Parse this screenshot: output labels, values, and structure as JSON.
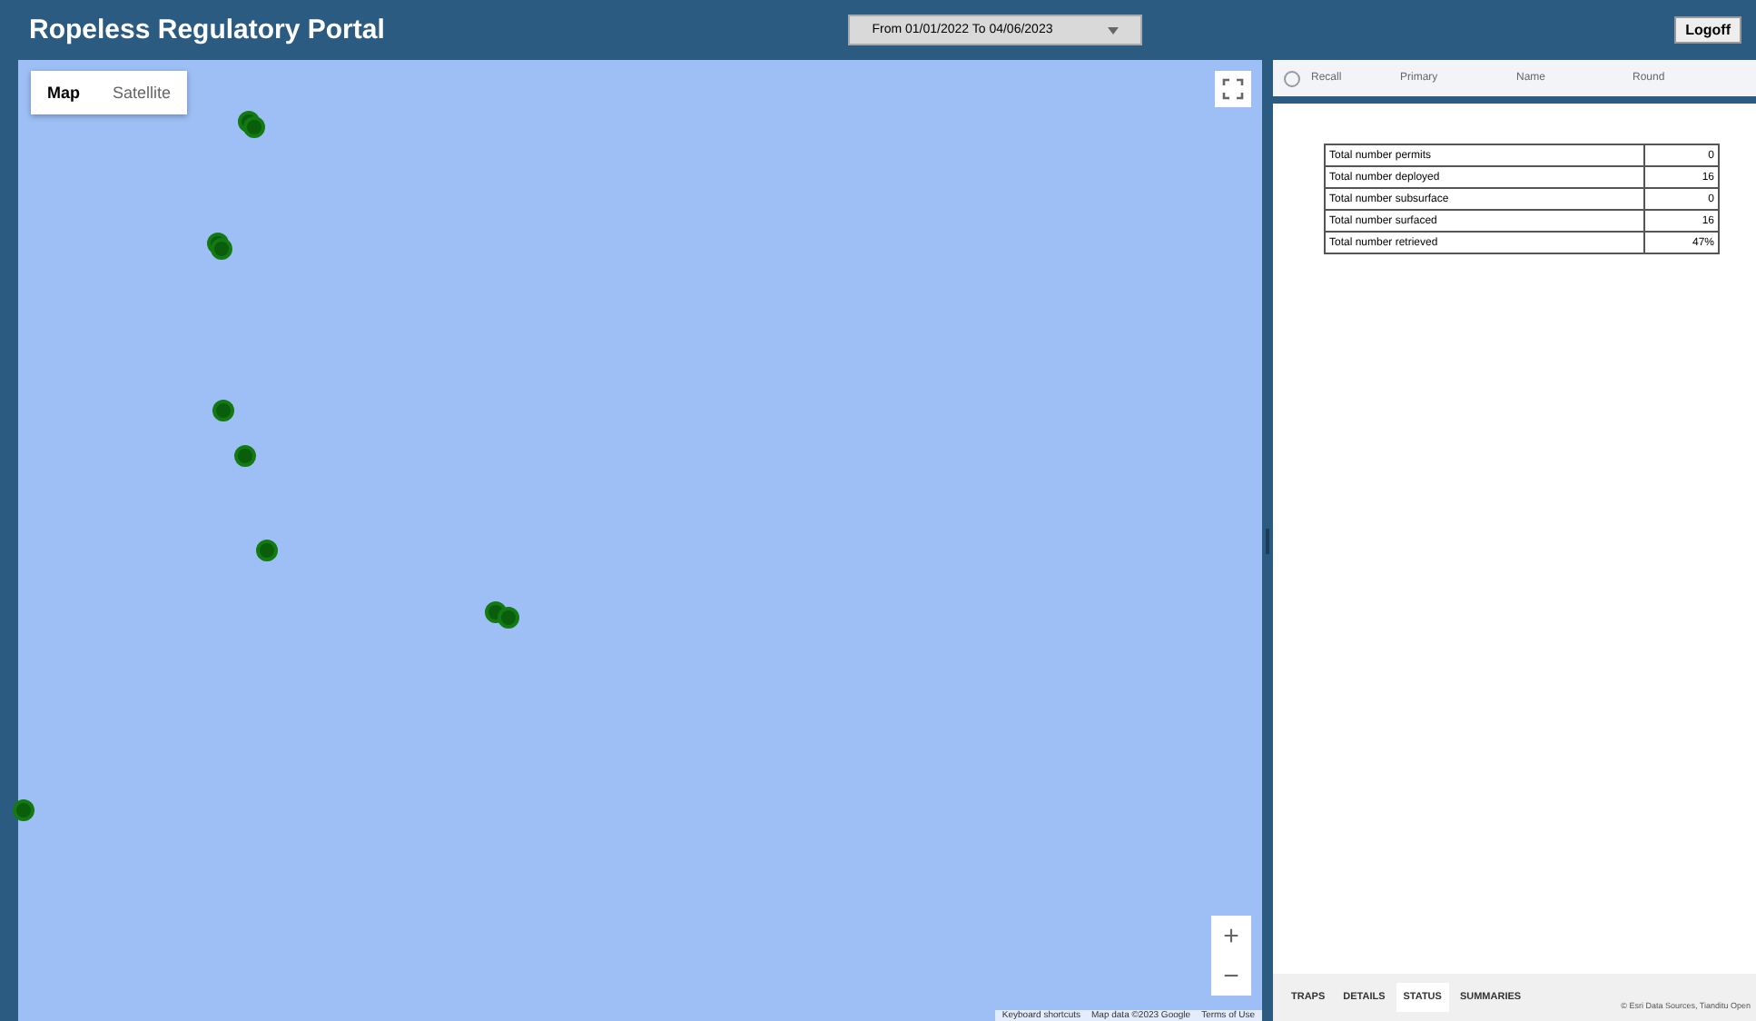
{
  "header": {
    "title": "Ropeless Regulatory Portal",
    "date_range": "From 01/01/2022 To 04/06/2023",
    "logoff": "Logoff"
  },
  "map": {
    "types": [
      {
        "label": "Map",
        "selected": true
      },
      {
        "label": "Satellite",
        "selected": false
      }
    ],
    "zoom_in": "+",
    "zoom_out": "−",
    "footer": [
      "Keyboard shortcuts",
      "Map data ©2023 Google",
      "Terms of Use"
    ]
  },
  "panel": {
    "columns": [
      {
        "label": "Recall",
        "checked": false
      },
      {
        "label": "Primary"
      },
      {
        "label": "Name"
      },
      {
        "label": "Round"
      }
    ],
    "stats": [
      {
        "label": "Total number permits",
        "value": "0"
      },
      {
        "label": "Total number deployed",
        "value": "16"
      },
      {
        "label": "Total number subsurface",
        "value": "0"
      },
      {
        "label": "Total number surfaced",
        "value": "16"
      },
      {
        "label": "Total number retrieved",
        "value": "47%"
      }
    ],
    "tabs": [
      {
        "label": "TRAPS",
        "selected": false
      },
      {
        "label": "DETAILS",
        "selected": false
      },
      {
        "label": "STATUS",
        "selected": true
      },
      {
        "label": "SUMMARIES",
        "selected": false
      }
    ],
    "attribution": "© Esri Data Sources, Tianditu Open"
  }
}
